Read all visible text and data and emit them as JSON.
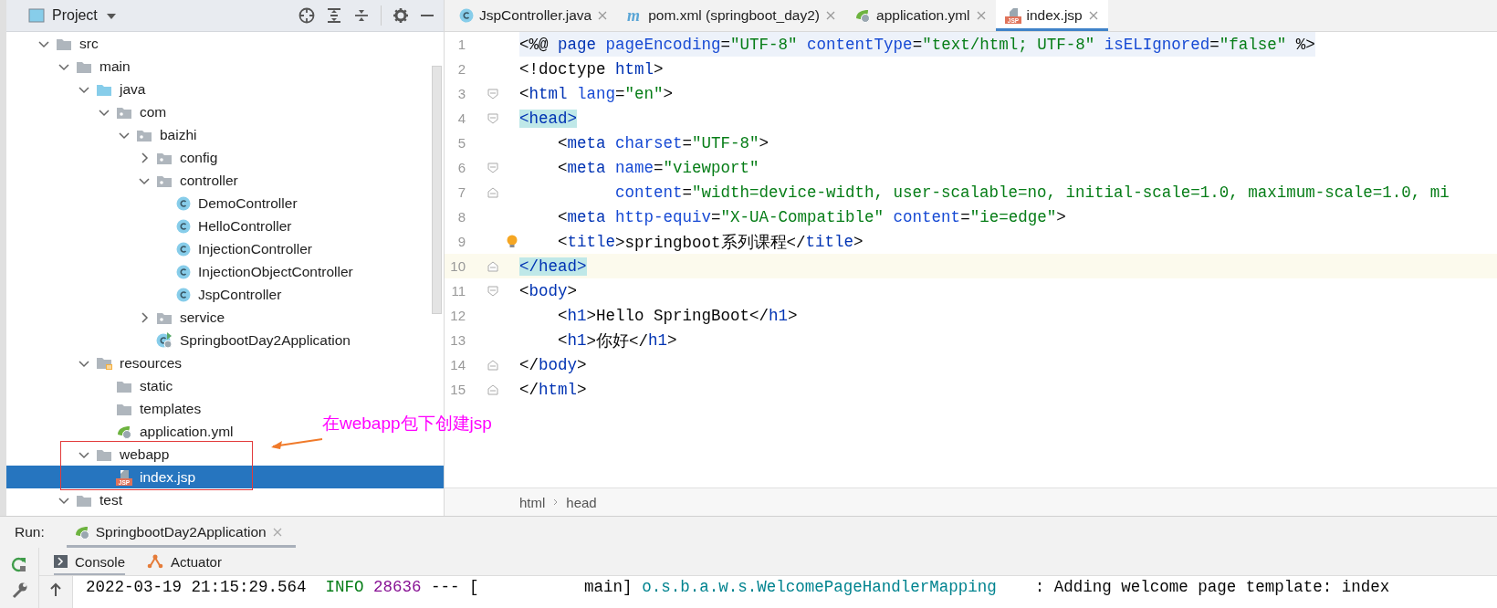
{
  "project_panel": {
    "title": "Project",
    "tree": [
      {
        "label": "src",
        "kind": "folder",
        "expanded": true,
        "selected": false,
        "children": [
          {
            "label": "main",
            "kind": "folder",
            "expanded": true,
            "selected": false,
            "children": [
              {
                "label": "java",
                "kind": "source-folder",
                "expanded": true,
                "selected": false,
                "children": [
                  {
                    "label": "com",
                    "kind": "package",
                    "expanded": true,
                    "selected": false,
                    "children": [
                      {
                        "label": "baizhi",
                        "kind": "package",
                        "expanded": true,
                        "selected": false,
                        "children": [
                          {
                            "label": "config",
                            "kind": "package",
                            "expanded": false,
                            "selected": false
                          },
                          {
                            "label": "controller",
                            "kind": "package",
                            "expanded": true,
                            "selected": false,
                            "children": [
                              {
                                "label": "DemoController",
                                "kind": "class",
                                "selected": false
                              },
                              {
                                "label": "HelloController",
                                "kind": "class",
                                "selected": false
                              },
                              {
                                "label": "InjectionController",
                                "kind": "class",
                                "selected": false
                              },
                              {
                                "label": "InjectionObjectController",
                                "kind": "class",
                                "selected": false
                              },
                              {
                                "label": "JspController",
                                "kind": "class",
                                "selected": false
                              }
                            ]
                          },
                          {
                            "label": "service",
                            "kind": "package",
                            "expanded": false,
                            "selected": false
                          },
                          {
                            "label": "SpringbootDay2Application",
                            "kind": "app-class",
                            "selected": false
                          }
                        ]
                      }
                    ]
                  }
                ]
              },
              {
                "label": "resources",
                "kind": "resources",
                "expanded": true,
                "selected": false,
                "children": [
                  {
                    "label": "static",
                    "kind": "folder",
                    "selected": false
                  },
                  {
                    "label": "templates",
                    "kind": "folder",
                    "selected": false
                  },
                  {
                    "label": "application.yml",
                    "kind": "yml",
                    "selected": false
                  }
                ]
              },
              {
                "label": "webapp",
                "kind": "folder",
                "expanded": true,
                "selected": false,
                "children": [
                  {
                    "label": "index.jsp",
                    "kind": "jsp",
                    "icon_label": "JSP",
                    "selected": true
                  }
                ]
              }
            ]
          },
          {
            "label": "test",
            "kind": "folder",
            "expanded": true,
            "selected": false
          }
        ]
      }
    ]
  },
  "annotation": {
    "text": "在webapp包下创建jsp",
    "color": "#ff00ff"
  },
  "editor": {
    "tabs": [
      {
        "label": "JspController.java",
        "kind": "class",
        "selected": false
      },
      {
        "label": "pom.xml (springboot_day2)",
        "kind": "maven",
        "icon_label": "m",
        "selected": false
      },
      {
        "label": "application.yml",
        "kind": "yml",
        "selected": false
      },
      {
        "label": "index.jsp",
        "kind": "jsp",
        "icon_label": "JSP",
        "selected": true
      }
    ],
    "lines": [
      {
        "number": "1",
        "kind": "plain",
        "hint": false,
        "current": false,
        "injected": true,
        "tokens": [
          {
            "kind": "plain",
            "text": "<%@ "
          },
          {
            "kind": "tag",
            "text": "page "
          },
          {
            "kind": "attr",
            "text": "pageEncoding"
          },
          {
            "kind": "plain",
            "text": "="
          },
          {
            "kind": "str",
            "text": "\"UTF-8\" "
          },
          {
            "kind": "attr",
            "text": "contentType"
          },
          {
            "kind": "plain",
            "text": "="
          },
          {
            "kind": "str",
            "text": "\"text/html; UTF-8\" "
          },
          {
            "kind": "attr",
            "text": "isELIgnored"
          },
          {
            "kind": "plain",
            "text": "="
          },
          {
            "kind": "str",
            "text": "\"false\" "
          },
          {
            "kind": "plain",
            "text": "%>"
          }
        ]
      },
      {
        "number": "2",
        "kind": "plain",
        "hint": false,
        "current": false,
        "injected": false,
        "tokens": [
          {
            "kind": "plain",
            "text": "<!doctype "
          },
          {
            "kind": "tag",
            "text": "html"
          },
          {
            "kind": "plain",
            "text": ">"
          }
        ]
      },
      {
        "number": "3",
        "kind": "fold-start",
        "hint": false,
        "current": false,
        "injected": false,
        "tokens": [
          {
            "kind": "plain",
            "text": "<"
          },
          {
            "kind": "tag",
            "text": "html "
          },
          {
            "kind": "attr",
            "text": "lang"
          },
          {
            "kind": "plain",
            "text": "="
          },
          {
            "kind": "str",
            "text": "\"en\""
          },
          {
            "kind": "plain",
            "text": ">"
          }
        ]
      },
      {
        "number": "4",
        "kind": "fold-start",
        "hint": false,
        "current": false,
        "injected": false,
        "tokens": [
          {
            "kind": "match",
            "text": "<head>"
          }
        ]
      },
      {
        "number": "5",
        "kind": "plain",
        "hint": false,
        "current": false,
        "injected": false,
        "tokens": [
          {
            "kind": "plain",
            "text": "    <"
          },
          {
            "kind": "tag",
            "text": "meta "
          },
          {
            "kind": "attr",
            "text": "charset"
          },
          {
            "kind": "plain",
            "text": "="
          },
          {
            "kind": "str",
            "text": "\"UTF-8\""
          },
          {
            "kind": "plain",
            "text": ">"
          }
        ]
      },
      {
        "number": "6",
        "kind": "fold-start",
        "hint": false,
        "current": false,
        "injected": false,
        "tokens": [
          {
            "kind": "plain",
            "text": "    <"
          },
          {
            "kind": "tag",
            "text": "meta "
          },
          {
            "kind": "attr",
            "text": "name"
          },
          {
            "kind": "plain",
            "text": "="
          },
          {
            "kind": "str",
            "text": "\"viewport\""
          }
        ]
      },
      {
        "number": "7",
        "kind": "fold-end",
        "hint": false,
        "current": false,
        "injected": false,
        "tokens": [
          {
            "kind": "attr",
            "text": "          content"
          },
          {
            "kind": "plain",
            "text": "="
          },
          {
            "kind": "str",
            "text": "\"width=device-width, user-scalable=no, initial-scale=1.0, maximum-scale=1.0, mi"
          }
        ]
      },
      {
        "number": "8",
        "kind": "plain",
        "hint": false,
        "current": false,
        "injected": false,
        "tokens": [
          {
            "kind": "plain",
            "text": "    <"
          },
          {
            "kind": "tag",
            "text": "meta "
          },
          {
            "kind": "attr",
            "text": "http-equiv"
          },
          {
            "kind": "plain",
            "text": "="
          },
          {
            "kind": "str",
            "text": "\"X-UA-Compatible\" "
          },
          {
            "kind": "attr",
            "text": "content"
          },
          {
            "kind": "plain",
            "text": "="
          },
          {
            "kind": "str",
            "text": "\"ie=edge\""
          },
          {
            "kind": "plain",
            "text": ">"
          }
        ]
      },
      {
        "number": "9",
        "kind": "plain",
        "hint": true,
        "current": false,
        "injected": false,
        "tokens": [
          {
            "kind": "plain",
            "text": "    <"
          },
          {
            "kind": "tag",
            "text": "title"
          },
          {
            "kind": "plain",
            "text": ">springboot系列课程</"
          },
          {
            "kind": "tag",
            "text": "title"
          },
          {
            "kind": "plain",
            "text": ">"
          }
        ]
      },
      {
        "number": "10",
        "kind": "fold-end",
        "hint": false,
        "current": true,
        "injected": false,
        "tokens": [
          {
            "kind": "match",
            "text": "</head>"
          }
        ]
      },
      {
        "number": "11",
        "kind": "fold-start",
        "hint": false,
        "current": false,
        "injected": false,
        "tokens": [
          {
            "kind": "plain",
            "text": "<"
          },
          {
            "kind": "tag",
            "text": "body"
          },
          {
            "kind": "plain",
            "text": ">"
          }
        ]
      },
      {
        "number": "12",
        "kind": "plain",
        "hint": false,
        "current": false,
        "injected": false,
        "tokens": [
          {
            "kind": "plain",
            "text": "    <"
          },
          {
            "kind": "tag",
            "text": "h1"
          },
          {
            "kind": "plain",
            "text": ">Hello SpringBoot</"
          },
          {
            "kind": "tag",
            "text": "h1"
          },
          {
            "kind": "plain",
            "text": ">"
          }
        ]
      },
      {
        "number": "13",
        "kind": "plain",
        "hint": false,
        "current": false,
        "injected": false,
        "tokens": [
          {
            "kind": "plain",
            "text": "    <"
          },
          {
            "kind": "tag",
            "text": "h1"
          },
          {
            "kind": "plain",
            "text": ">你好</"
          },
          {
            "kind": "tag",
            "text": "h1"
          },
          {
            "kind": "plain",
            "text": ">"
          }
        ]
      },
      {
        "number": "14",
        "kind": "fold-end",
        "hint": false,
        "current": false,
        "injected": false,
        "tokens": [
          {
            "kind": "plain",
            "text": "</"
          },
          {
            "kind": "tag",
            "text": "body"
          },
          {
            "kind": "plain",
            "text": ">"
          }
        ]
      },
      {
        "number": "15",
        "kind": "fold-end",
        "hint": false,
        "current": false,
        "injected": false,
        "tokens": [
          {
            "kind": "plain",
            "text": "</"
          },
          {
            "kind": "tag",
            "text": "html"
          },
          {
            "kind": "plain",
            "text": ">"
          }
        ]
      }
    ],
    "breadcrumbs": [
      "html",
      "head"
    ]
  },
  "run_panel": {
    "label": "Run:",
    "config_tab": "SpringbootDay2Application",
    "tabs": [
      {
        "label": "Console",
        "kind": "console",
        "selected": true
      },
      {
        "label": "Actuator",
        "kind": "actuator",
        "selected": false
      }
    ],
    "log": [
      {
        "kind": "plain",
        "text": "2022-03-19 21:15:29.564  "
      },
      {
        "kind": "level",
        "text": "INFO "
      },
      {
        "kind": "pid",
        "text": "28636"
      },
      {
        "kind": "plain",
        "text": " --- [           main] "
      },
      {
        "kind": "logger",
        "text": "o.s.b.a.w.s.WelcomePageHandlerMapping"
      },
      {
        "kind": "plain",
        "text": "    : Adding welcome page template: index"
      }
    ]
  }
}
